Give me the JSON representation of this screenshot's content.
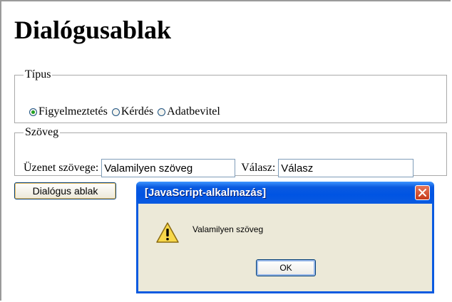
{
  "page": {
    "title": "Dialógusablak"
  },
  "type_group": {
    "legend": "Típus",
    "options": [
      {
        "label": "Figyelmeztetés",
        "checked": true
      },
      {
        "label": "Kérdés",
        "checked": false
      },
      {
        "label": "Adatbevitel",
        "checked": false
      }
    ]
  },
  "text_group": {
    "legend": "Szöveg",
    "message_label": "Üzenet szövege:",
    "message_value": "Valamilyen szöveg",
    "answer_label": "Válasz:",
    "answer_value": "Válasz"
  },
  "dialog_button_label": "Dialógus ablak",
  "alert": {
    "title": "[JavaScript-alkalmazás]",
    "message": "Valamilyen szöveg",
    "ok_label": "OK",
    "icon": "warning-icon"
  },
  "colors": {
    "titlebar": "#0a5ae0",
    "dialog_bg": "#ece9d8",
    "close": "#c6391a"
  }
}
